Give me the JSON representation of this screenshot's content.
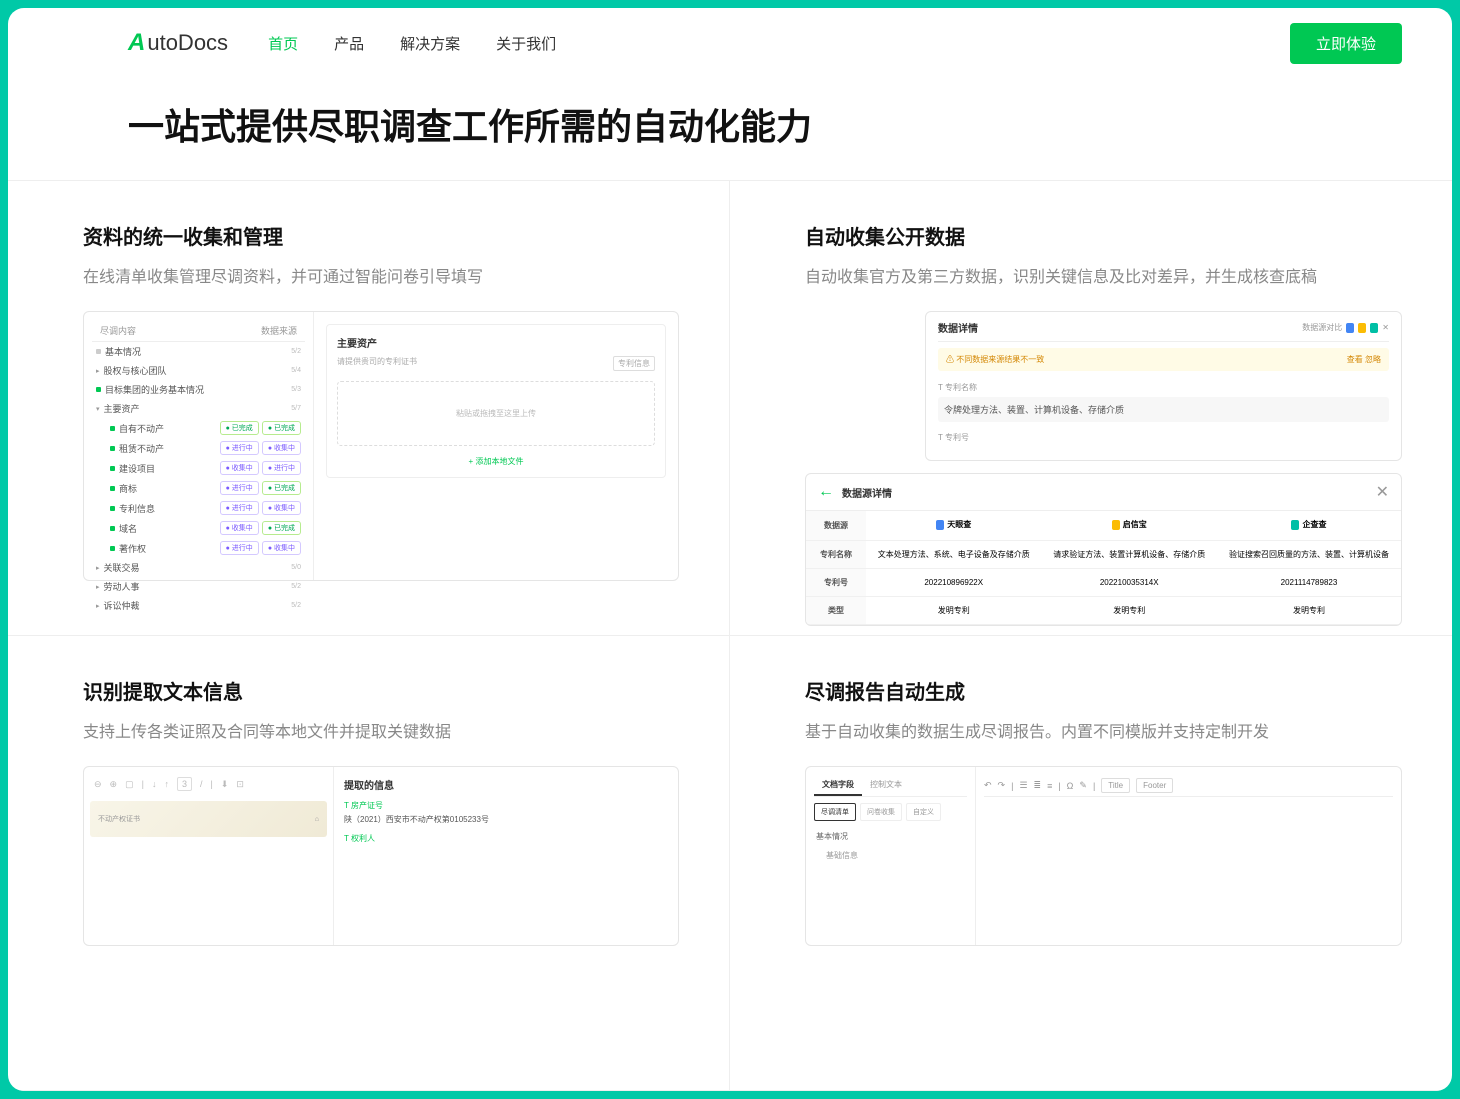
{
  "brand": {
    "mark": "A",
    "name": "utoDocs"
  },
  "nav": {
    "items": [
      "首页",
      "产品",
      "解决方案",
      "关于我们"
    ],
    "cta": "立即体验"
  },
  "hero": {
    "title": "一站式提供尽职调查工作所需的自动化能力"
  },
  "cells": [
    {
      "title": "资料的统一收集和管理",
      "desc": "在线清单收集管理尽调资料，并可通过智能问卷引导填写",
      "mock": {
        "hdr_left": "尽调内容",
        "hdr_right": "数据来源",
        "tree": [
          {
            "type": "dot-gray",
            "label": "基本情况",
            "count": "5/2"
          },
          {
            "type": "caret",
            "label": "股权与核心团队",
            "count": "5/4"
          },
          {
            "type": "dot",
            "label": "目标集团的业务基本情况",
            "count": "5/3"
          },
          {
            "type": "caret-open",
            "label": "主要资产",
            "count": "5/7"
          },
          {
            "type": "dot",
            "indent": true,
            "label": "自有不动产",
            "badges": [
              "已完成",
              "已完成"
            ]
          },
          {
            "type": "dot",
            "indent": true,
            "label": "租赁不动产",
            "badges": [
              "进行中",
              "收集中"
            ]
          },
          {
            "type": "dot",
            "indent": true,
            "label": "建设项目",
            "badges": [
              "收集中",
              "进行中"
            ]
          },
          {
            "type": "dot",
            "indent": true,
            "label": "商标",
            "badges": [
              "进行中",
              "已完成"
            ]
          },
          {
            "type": "dot",
            "indent": true,
            "label": "专利信息",
            "badges": [
              "进行中",
              "收集中"
            ]
          },
          {
            "type": "dot",
            "indent": true,
            "label": "域名",
            "badges": [
              "收集中",
              "已完成"
            ]
          },
          {
            "type": "dot",
            "indent": true,
            "label": "著作权",
            "badges": [
              "进行中",
              "收集中"
            ]
          },
          {
            "type": "caret",
            "label": "关联交易",
            "count": "5/0"
          },
          {
            "type": "caret",
            "label": "劳动人事",
            "count": "5/2"
          },
          {
            "type": "caret",
            "label": "诉讼仲裁",
            "count": "5/2"
          }
        ],
        "panel_title": "主要资产",
        "panel_sub": "请提供贵司的专利证书",
        "panel_tag": "专利信息",
        "dropzone": "粘贴或拖拽至这里上传",
        "add_local": "+ 添加本地文件"
      }
    },
    {
      "title": "自动收集公开数据",
      "desc": "自动收集官方及第三方数据，识别关键信息及比对差异，并生成核查底稿",
      "mock": {
        "top_title": "数据详情",
        "top_compare": "数据源对比",
        "warn_left": "不同数据来源结果不一致",
        "warn_right": "查看   忽略",
        "field1_label": "T 专利名称",
        "field1_val": "令牌处理方法、装置、计算机设备、存储介质",
        "field2_label": "T 专利号",
        "detail_title": "数据源详情",
        "table": {
          "row_hdr": "数据源",
          "sources": [
            {
              "icon": "b",
              "name": "天眼查"
            },
            {
              "icon": "y",
              "name": "启信宝"
            },
            {
              "icon": "t",
              "name": "企查查"
            }
          ],
          "rows": [
            {
              "h": "专利名称",
              "v": [
                "文本处理方法、系统、电子设备及存储介质",
                "请求验证方法、装置计算机设备、存储介质",
                "验证搜索召回质量的方法、装置、计算机设备"
              ]
            },
            {
              "h": "专利号",
              "v": [
                "202210896922X",
                "202210035314X",
                "2021114789823"
              ]
            },
            {
              "h": "类型",
              "v": [
                "发明专利",
                "发明专利",
                "发明专利"
              ]
            }
          ]
        }
      }
    },
    {
      "title": "识别提取文本信息",
      "desc": "支持上传各类证照及合同等本地文件并提取关键数据",
      "mock": {
        "page": "3",
        "info_title": "提取的信息",
        "field1_label": "T 房产证号",
        "field1_val": "陕（2021）西安市不动产权第0105233号",
        "field2_label": "T 权利人",
        "preview_left": "不动产权证书"
      }
    },
    {
      "title": "尽调报告自动生成",
      "desc": "基于自动收集的数据生成尽调报告。内置不同模版并支持定制开发",
      "mock": {
        "tabs": [
          "文档字段",
          "控制文本"
        ],
        "subtabs": [
          "尽调清单",
          "问卷收集",
          "自定义"
        ],
        "sections": [
          "基本情况",
          "基础信息"
        ],
        "toolbar_boxes": [
          "Title",
          "Footer"
        ]
      }
    }
  ]
}
